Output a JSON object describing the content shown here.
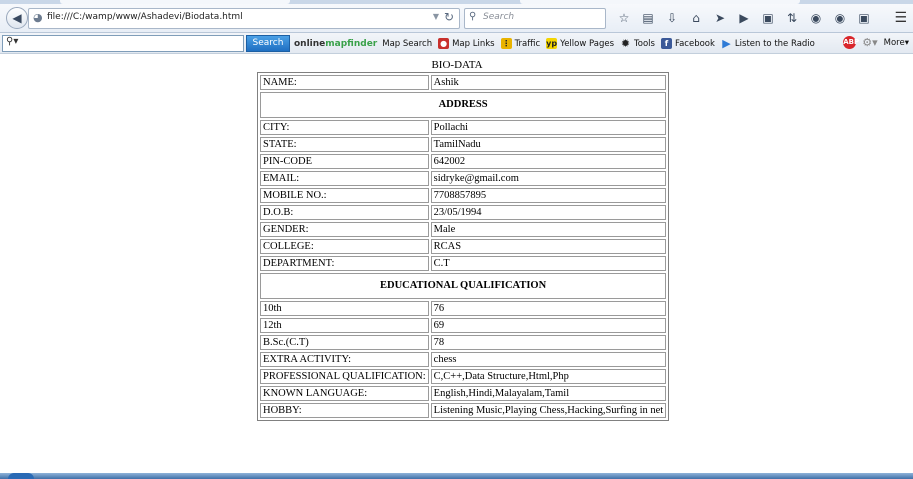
{
  "browser": {
    "url": "file:///C:/wamp/www/Ashadevi/Biodata.html",
    "search_placeholder": "Search",
    "nav_icons": [
      "star-icon",
      "reading-list-icon",
      "download-icon",
      "home-icon",
      "send-icon",
      "youtube-icon",
      "pocket-icon",
      "sync-icon",
      "addon-icon",
      "chat-icon",
      "save-icon"
    ]
  },
  "toolbar": {
    "search_label": "Search",
    "brand_part1": "online",
    "brand_part2": "mapfinder",
    "items": [
      "Map Search",
      "Map Links",
      "Traffic",
      "Yellow Pages",
      "Tools",
      "Facebook",
      "Listen to the Radio"
    ],
    "more_label": "More"
  },
  "page": {
    "title": "BIO-DATA",
    "name_label": "NAME:",
    "name_value": "Ashik",
    "address_heading": "ADDRESS",
    "address": [
      {
        "label": "CITY:",
        "value": "Pollachi"
      },
      {
        "label": "STATE:",
        "value": "TamilNadu"
      },
      {
        "label": "PIN-CODE",
        "value": "642002"
      },
      {
        "label": "EMAIL:",
        "value": "sidryke@gmail.com"
      },
      {
        "label": "MOBILE NO.:",
        "value": "7708857895"
      },
      {
        "label": "D.O.B:",
        "value": "23/05/1994"
      },
      {
        "label": "GENDER:",
        "value": "Male"
      },
      {
        "label": "COLLEGE:",
        "value": "RCAS"
      },
      {
        "label": "DEPARTMENT:",
        "value": "C.T"
      }
    ],
    "education_heading": "EDUCATIONAL QUALIFICATION",
    "education": [
      {
        "label": "10th",
        "value": "76"
      },
      {
        "label": "12th",
        "value": "69"
      },
      {
        "label": "B.Sc.(C.T)",
        "value": "78"
      },
      {
        "label": "EXTRA ACTIVITY:",
        "value": "chess"
      },
      {
        "label": "PROFESSIONAL QUALIFICATION:",
        "value": "C,C++,Data Structure,Html,Php"
      },
      {
        "label": "KNOWN LANGUAGE:",
        "value": "English,Hindi,Malayalam,Tamil"
      },
      {
        "label": "HOBBY:",
        "value": "Listening Music,Playing Chess,Hacking,Surfing in net"
      }
    ]
  }
}
